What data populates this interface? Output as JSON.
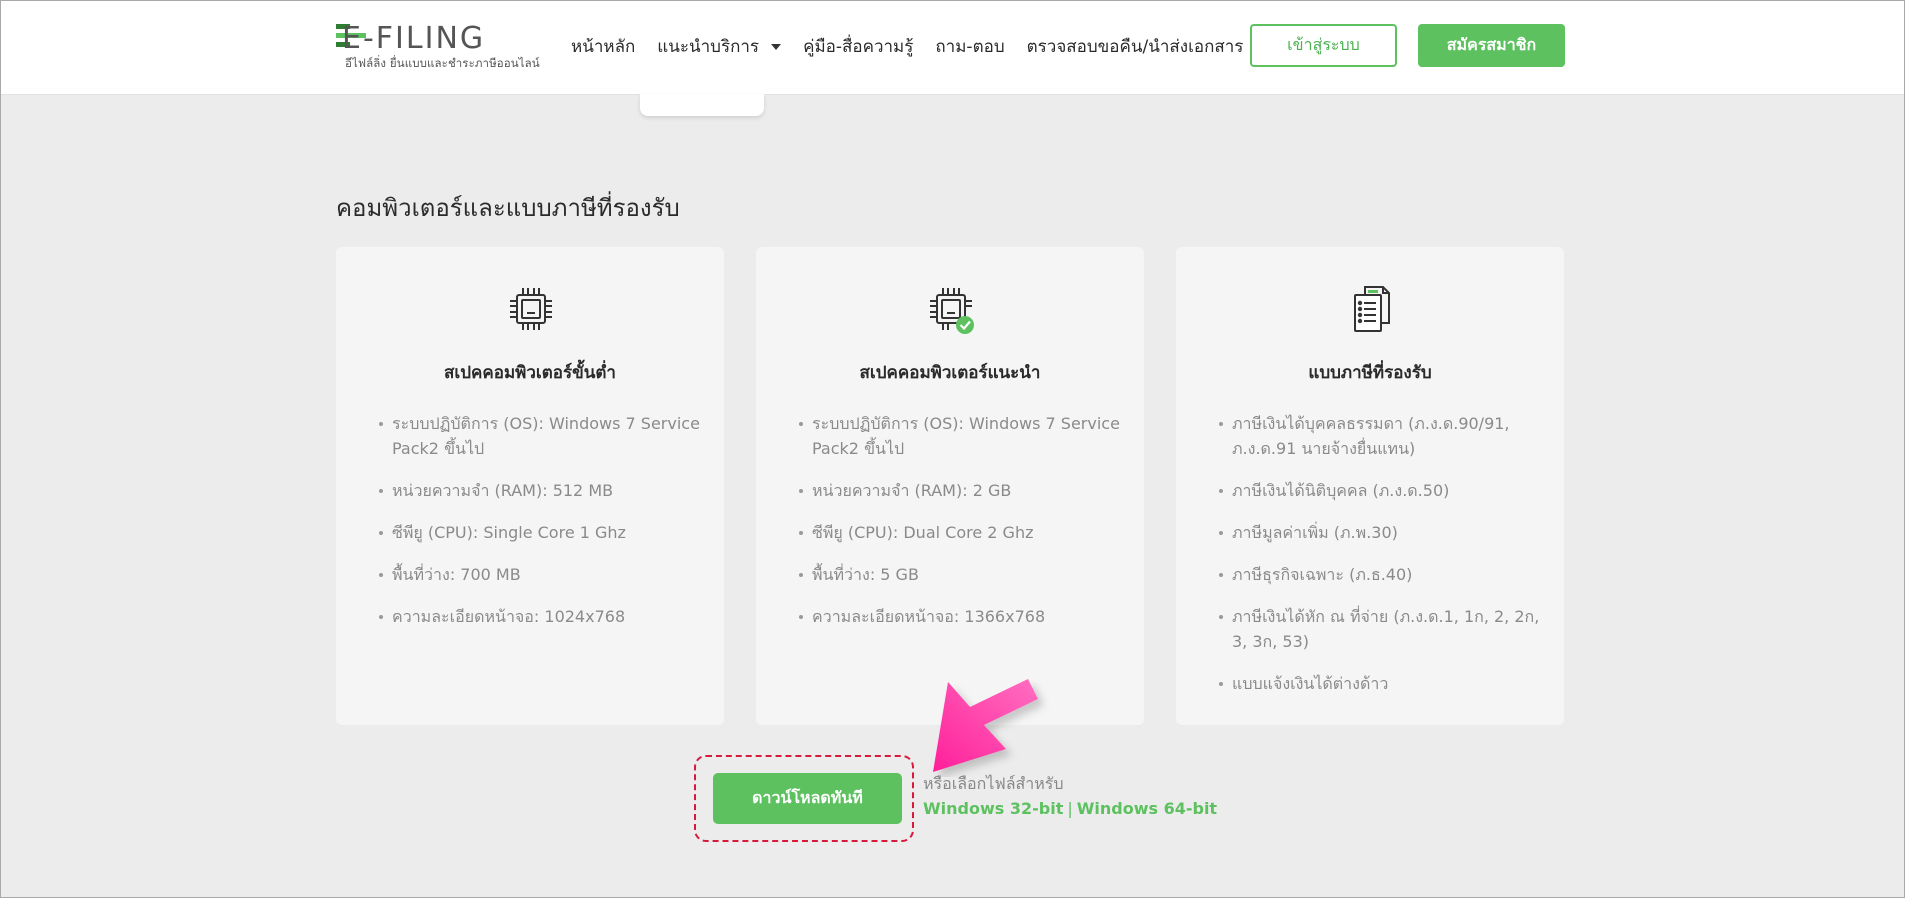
{
  "header": {
    "logo_text": "E-FILING",
    "logo_tagline": "อีไฟล์ลิ่ง ยื่นแบบและชำระภาษีออนไลน์",
    "nav": [
      {
        "label": "หน้าหลัก"
      },
      {
        "label": "แนะนำบริการ"
      },
      {
        "label": "คู่มือ-สื่อความรู้"
      },
      {
        "label": "ถาม-ตอบ"
      },
      {
        "label": "ตรวจสอบขอคืน/นำส่งเอกสาร"
      }
    ],
    "login_label": "เข้าสู่ระบบ",
    "register_label": "สมัครสมาชิก"
  },
  "section": {
    "title": "คอมพิวเตอร์และแบบภาษีที่รองรับ"
  },
  "cards": [
    {
      "icon": "cpu-icon",
      "title": "สเปคคอมพิวเตอร์ขั้นต่ำ",
      "items": [
        "ระบบปฏิบัติการ (OS): Windows 7 Service Pack2 ขึ้นไป",
        "หน่วยความจำ (RAM): 512 MB",
        "ซีพียู (CPU): Single Core 1 Ghz",
        "พื้นที่ว่าง: 700 MB",
        "ความละเอียดหน้าจอ: 1024x768"
      ]
    },
    {
      "icon": "cpu-check-icon",
      "title": "สเปคคอมพิวเตอร์แนะนำ",
      "items": [
        "ระบบปฏิบัติการ (OS): Windows 7 Service Pack2 ขึ้นไป",
        "หน่วยความจำ (RAM): 2 GB",
        "ซีพียู (CPU): Dual Core 2 Ghz",
        "พื้นที่ว่าง: 5 GB",
        "ความละเอียดหน้าจอ: 1366x768"
      ]
    },
    {
      "icon": "tax-document-icon",
      "title": "แบบภาษีที่รองรับ",
      "items": [
        "ภาษีเงินได้บุคคลธรรมดา (ภ.ง.ด.90/91, ภ.ง.ด.91 นายจ้างยื่นแทน)",
        "ภาษีเงินได้นิติบุคคล (ภ.ง.ด.50)",
        "ภาษีมูลค่าเพิ่ม (ภ.พ.30)",
        "ภาษีธุรกิจเฉพาะ (ภ.ธ.40)",
        "ภาษีเงินได้หัก ณ ที่จ่าย (ภ.ง.ด.1, 1ก, 2, 2ก, 3, 3ก, 53)",
        "แบบแจ้งเงินได้ต่างด้าว"
      ]
    }
  ],
  "download": {
    "button_label": "ดาวน์โหลดทันที",
    "alt_text": "หรือเลือกไฟล์สำหรับ",
    "link_32": "Windows 32-bit",
    "separator": "|",
    "link_64": "Windows 64-bit"
  },
  "colors": {
    "brand_green": "#5cc15e",
    "highlight_red": "#d71a3c",
    "arrow_pink": "#ff3ea5"
  }
}
